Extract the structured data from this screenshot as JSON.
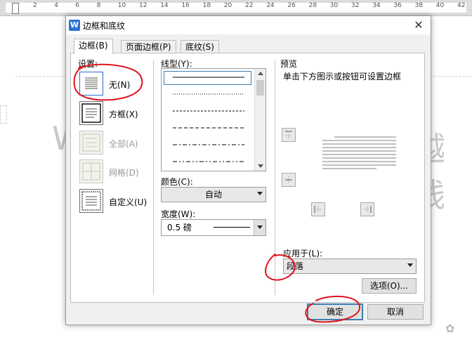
{
  "dialog": {
    "title": "边框和底纹",
    "close_glyph": "✕"
  },
  "ruler": {
    "ticks": [
      "2",
      "4",
      "6",
      "8",
      "10",
      "12",
      "14",
      "16",
      "18",
      "20",
      "22",
      "24",
      "26",
      "28",
      "30",
      "32",
      "34",
      "36",
      "38",
      "40",
      "42"
    ]
  },
  "background_doc": {
    "left_text": "W",
    "right_text": "越线"
  },
  "tabs": [
    {
      "label": "边框(B)",
      "active": true
    },
    {
      "label": "页面边框(P)",
      "active": false
    },
    {
      "label": "底纹(S)",
      "active": false
    }
  ],
  "settings": {
    "heading": "设置:",
    "items": [
      {
        "label": "无(N)",
        "enabled": true,
        "selected": true
      },
      {
        "label": "方框(X)",
        "enabled": true,
        "selected": false
      },
      {
        "label": "全部(A)",
        "enabled": false,
        "selected": false
      },
      {
        "label": "网格(D)",
        "enabled": false,
        "selected": false
      },
      {
        "label": "自定义(U)",
        "enabled": true,
        "selected": false
      }
    ]
  },
  "line_style": {
    "heading": "线型(Y):",
    "styles": [
      "solid",
      "dotted-fine",
      "dashed-small",
      "dashed-medium",
      "dash-dot",
      "dash-dot-dot"
    ]
  },
  "color": {
    "heading": "颜色(C):",
    "value": "自动"
  },
  "width": {
    "heading": "宽度(W):",
    "value": "0.5  磅"
  },
  "preview": {
    "heading": "预览",
    "hint": "单击下方图示或按钮可设置边框"
  },
  "apply_to": {
    "heading": "应用于(L):",
    "value": "段落"
  },
  "buttons": {
    "options": "选项(O)...",
    "ok": "确定",
    "cancel": "取消"
  },
  "colors": {
    "accent": "#3c7fb1",
    "annotation_red": "#e0141e",
    "app_icon": "#2b73d0"
  }
}
